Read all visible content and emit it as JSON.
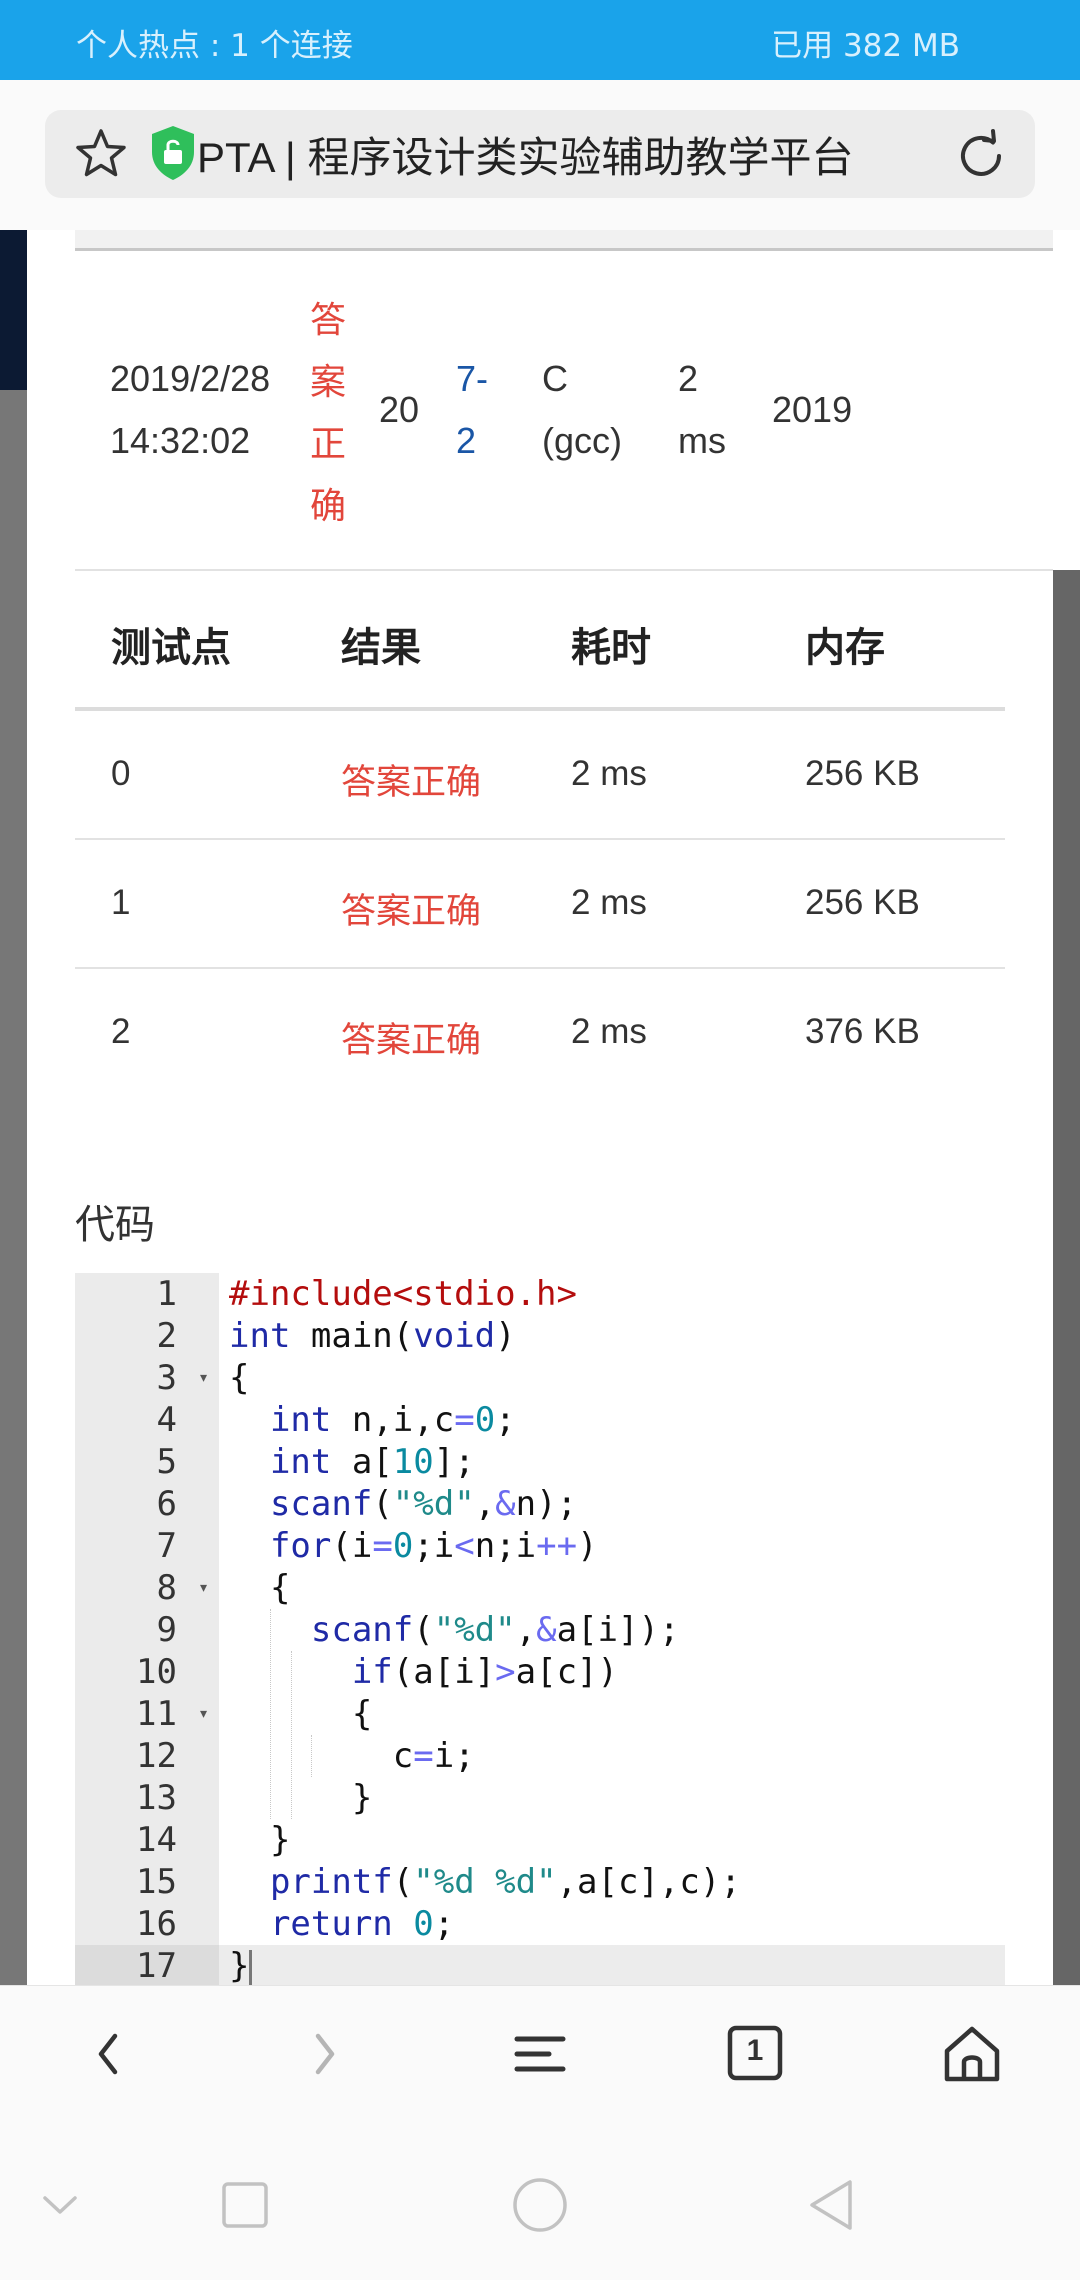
{
  "status_bar": {
    "hotspot": "个人热点 : 1 个连接",
    "memory": "已用 382 MB"
  },
  "address_bar": {
    "title": "PTA | 程序设计类实验辅助教学平台"
  },
  "submission": {
    "time_date": "2019/2/28",
    "time_clock": "14:32:02",
    "status_chars": [
      "答",
      "案",
      "正",
      "确"
    ],
    "score": "20",
    "problem_line1": "7-",
    "problem_line2": "2",
    "compiler_line1": "C",
    "compiler_line2": "(gcc)",
    "time_used_line1": "2",
    "time_used_line2": "ms",
    "extra": "2019"
  },
  "testcases": {
    "headers": [
      "测试点",
      "结果",
      "耗时",
      "内存"
    ],
    "rows": [
      {
        "point": "0",
        "result": "答案正确",
        "time": "2 ms",
        "memory": "256 KB"
      },
      {
        "point": "1",
        "result": "答案正确",
        "time": "2 ms",
        "memory": "256 KB"
      },
      {
        "point": "2",
        "result": "答案正确",
        "time": "2 ms",
        "memory": "376 KB"
      }
    ]
  },
  "code_section": {
    "title": "代码",
    "active_line": 17,
    "lines": [
      "#include<stdio.h>",
      "int main(void)",
      "{",
      "  int n,i,c=0;",
      "  int a[10];",
      "  scanf(\"%d\",&n);",
      "  for(i=0;i<n;i++)",
      "  {",
      "    scanf(\"%d\",&a[i]);",
      "      if(a[i]>a[c])",
      "      {",
      "        c=i;",
      "      }",
      "  }",
      "  printf(\"%d %d\",a[c],c);",
      "  return 0;",
      "}"
    ],
    "fold_lines": [
      3,
      8,
      11
    ]
  },
  "toolbar": {
    "icons": [
      "back-icon",
      "forward-icon",
      "menu-icon",
      "tabs-icon",
      "home-icon"
    ],
    "tab_count": "1"
  },
  "navbar": {
    "icons": [
      "hide-keyboard-icon",
      "recents-icon",
      "home-circle-icon",
      "back-triangle-icon"
    ]
  },
  "colors": {
    "status_bar": "#1aa3ea",
    "accepted": "#e2463b",
    "link": "#1a56a6"
  }
}
